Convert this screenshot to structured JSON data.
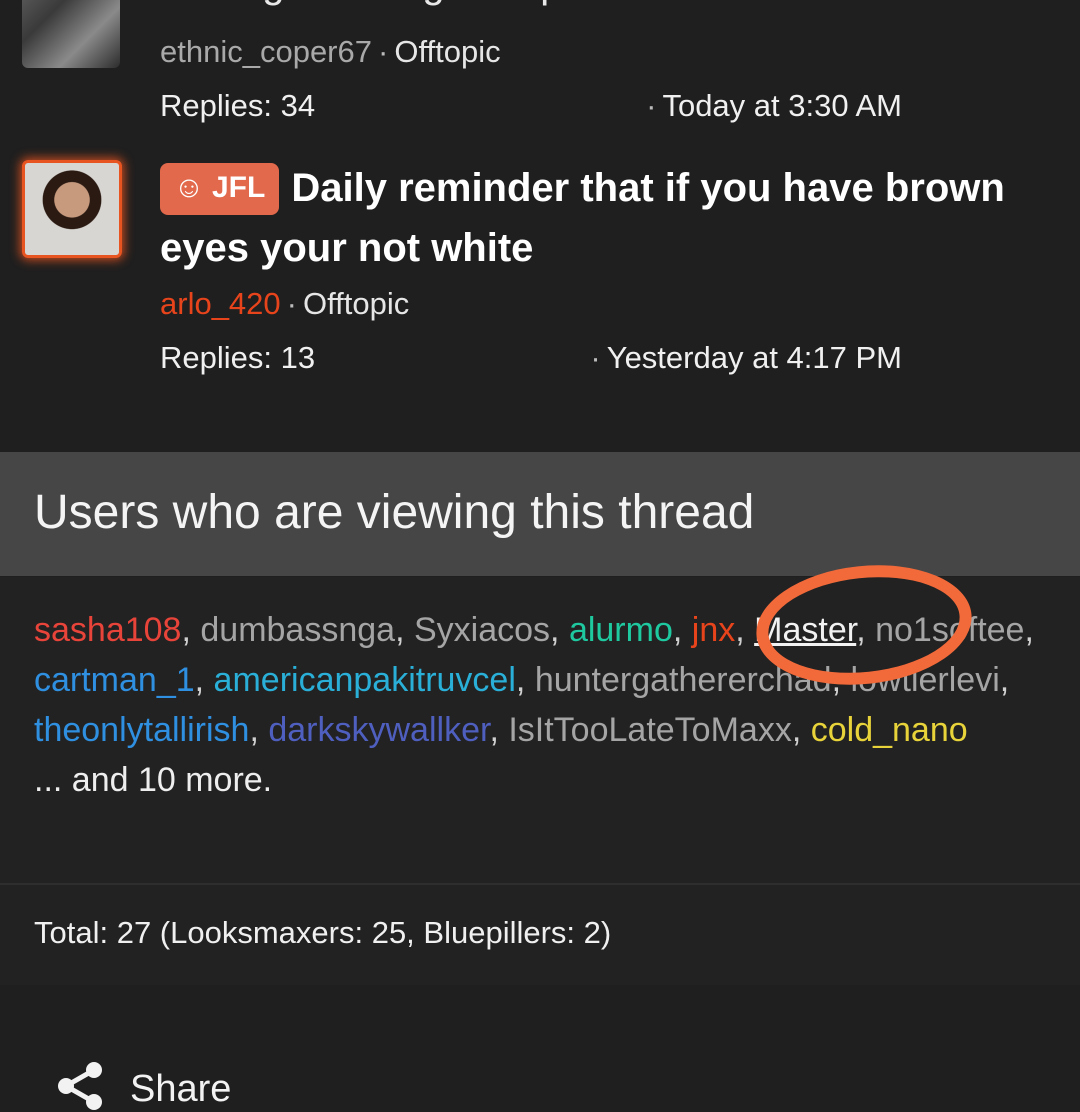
{
  "threads": [
    {
      "title": "Ending the Height Cope: The Brutal Truth",
      "author": "ethnic_coper67",
      "forum": "Offtopic",
      "replies": "Replies: 34",
      "time": "Today at 3:30 AM",
      "thumb_icon": "user-avatar-photo"
    },
    {
      "prefix": "JFL",
      "prefix_icon": "laughing-face-icon",
      "title": "Daily reminder that if you have brown eyes your not white",
      "author": "arlo_420",
      "forum": "Offtopic",
      "replies": "Replies: 13",
      "time": "Yesterday at 4:17 PM",
      "thumb_icon": "user-avatar-photo"
    }
  ],
  "separator_dot": "·",
  "viewers": {
    "title": "Users who are viewing this thread",
    "users": [
      {
        "name": "sasha108",
        "color": "#e8443a"
      },
      {
        "name": "dumbassnga",
        "color": "#a5a5a5"
      },
      {
        "name": "Syxiacos",
        "color": "#a5a5a5"
      },
      {
        "name": "alurmo",
        "color": "#1fc9a0"
      },
      {
        "name": "jnx",
        "color": "#e8441c"
      },
      {
        "name": "Master",
        "color": "#f2f2f2"
      },
      {
        "name": "no1softee",
        "color": "#a5a5a5"
      },
      {
        "name": "cartman_1",
        "color": "#2f8fe0"
      },
      {
        "name": "americanpakitruvcel",
        "color": "#2ab0d8"
      },
      {
        "name": "huntergathererchad",
        "color": "#a5a5a5"
      },
      {
        "name": "lowtierlevi",
        "color": "#a5a5a5"
      },
      {
        "name": "theonlytallirish",
        "color": "#2f8fe0"
      },
      {
        "name": "darkskywallker",
        "color": "#4f5fbf"
      },
      {
        "name": "IsItTooLateToMaxx",
        "color": "#a5a5a5"
      },
      {
        "name": "cold_nano",
        "color": "#e8d43a"
      }
    ],
    "more": "... and 10 more.",
    "total": "Total: 27 (Looksmaxers: 25, Bluepillers: 2)"
  },
  "share": {
    "label": "Share",
    "icon": "share-icon"
  },
  "colors": {
    "background": "#1f1f1f",
    "header_band": "#464646",
    "prefix_badge": "#e2694c",
    "annotation": "#f26a3a",
    "avatar_glow": "#e85420"
  }
}
